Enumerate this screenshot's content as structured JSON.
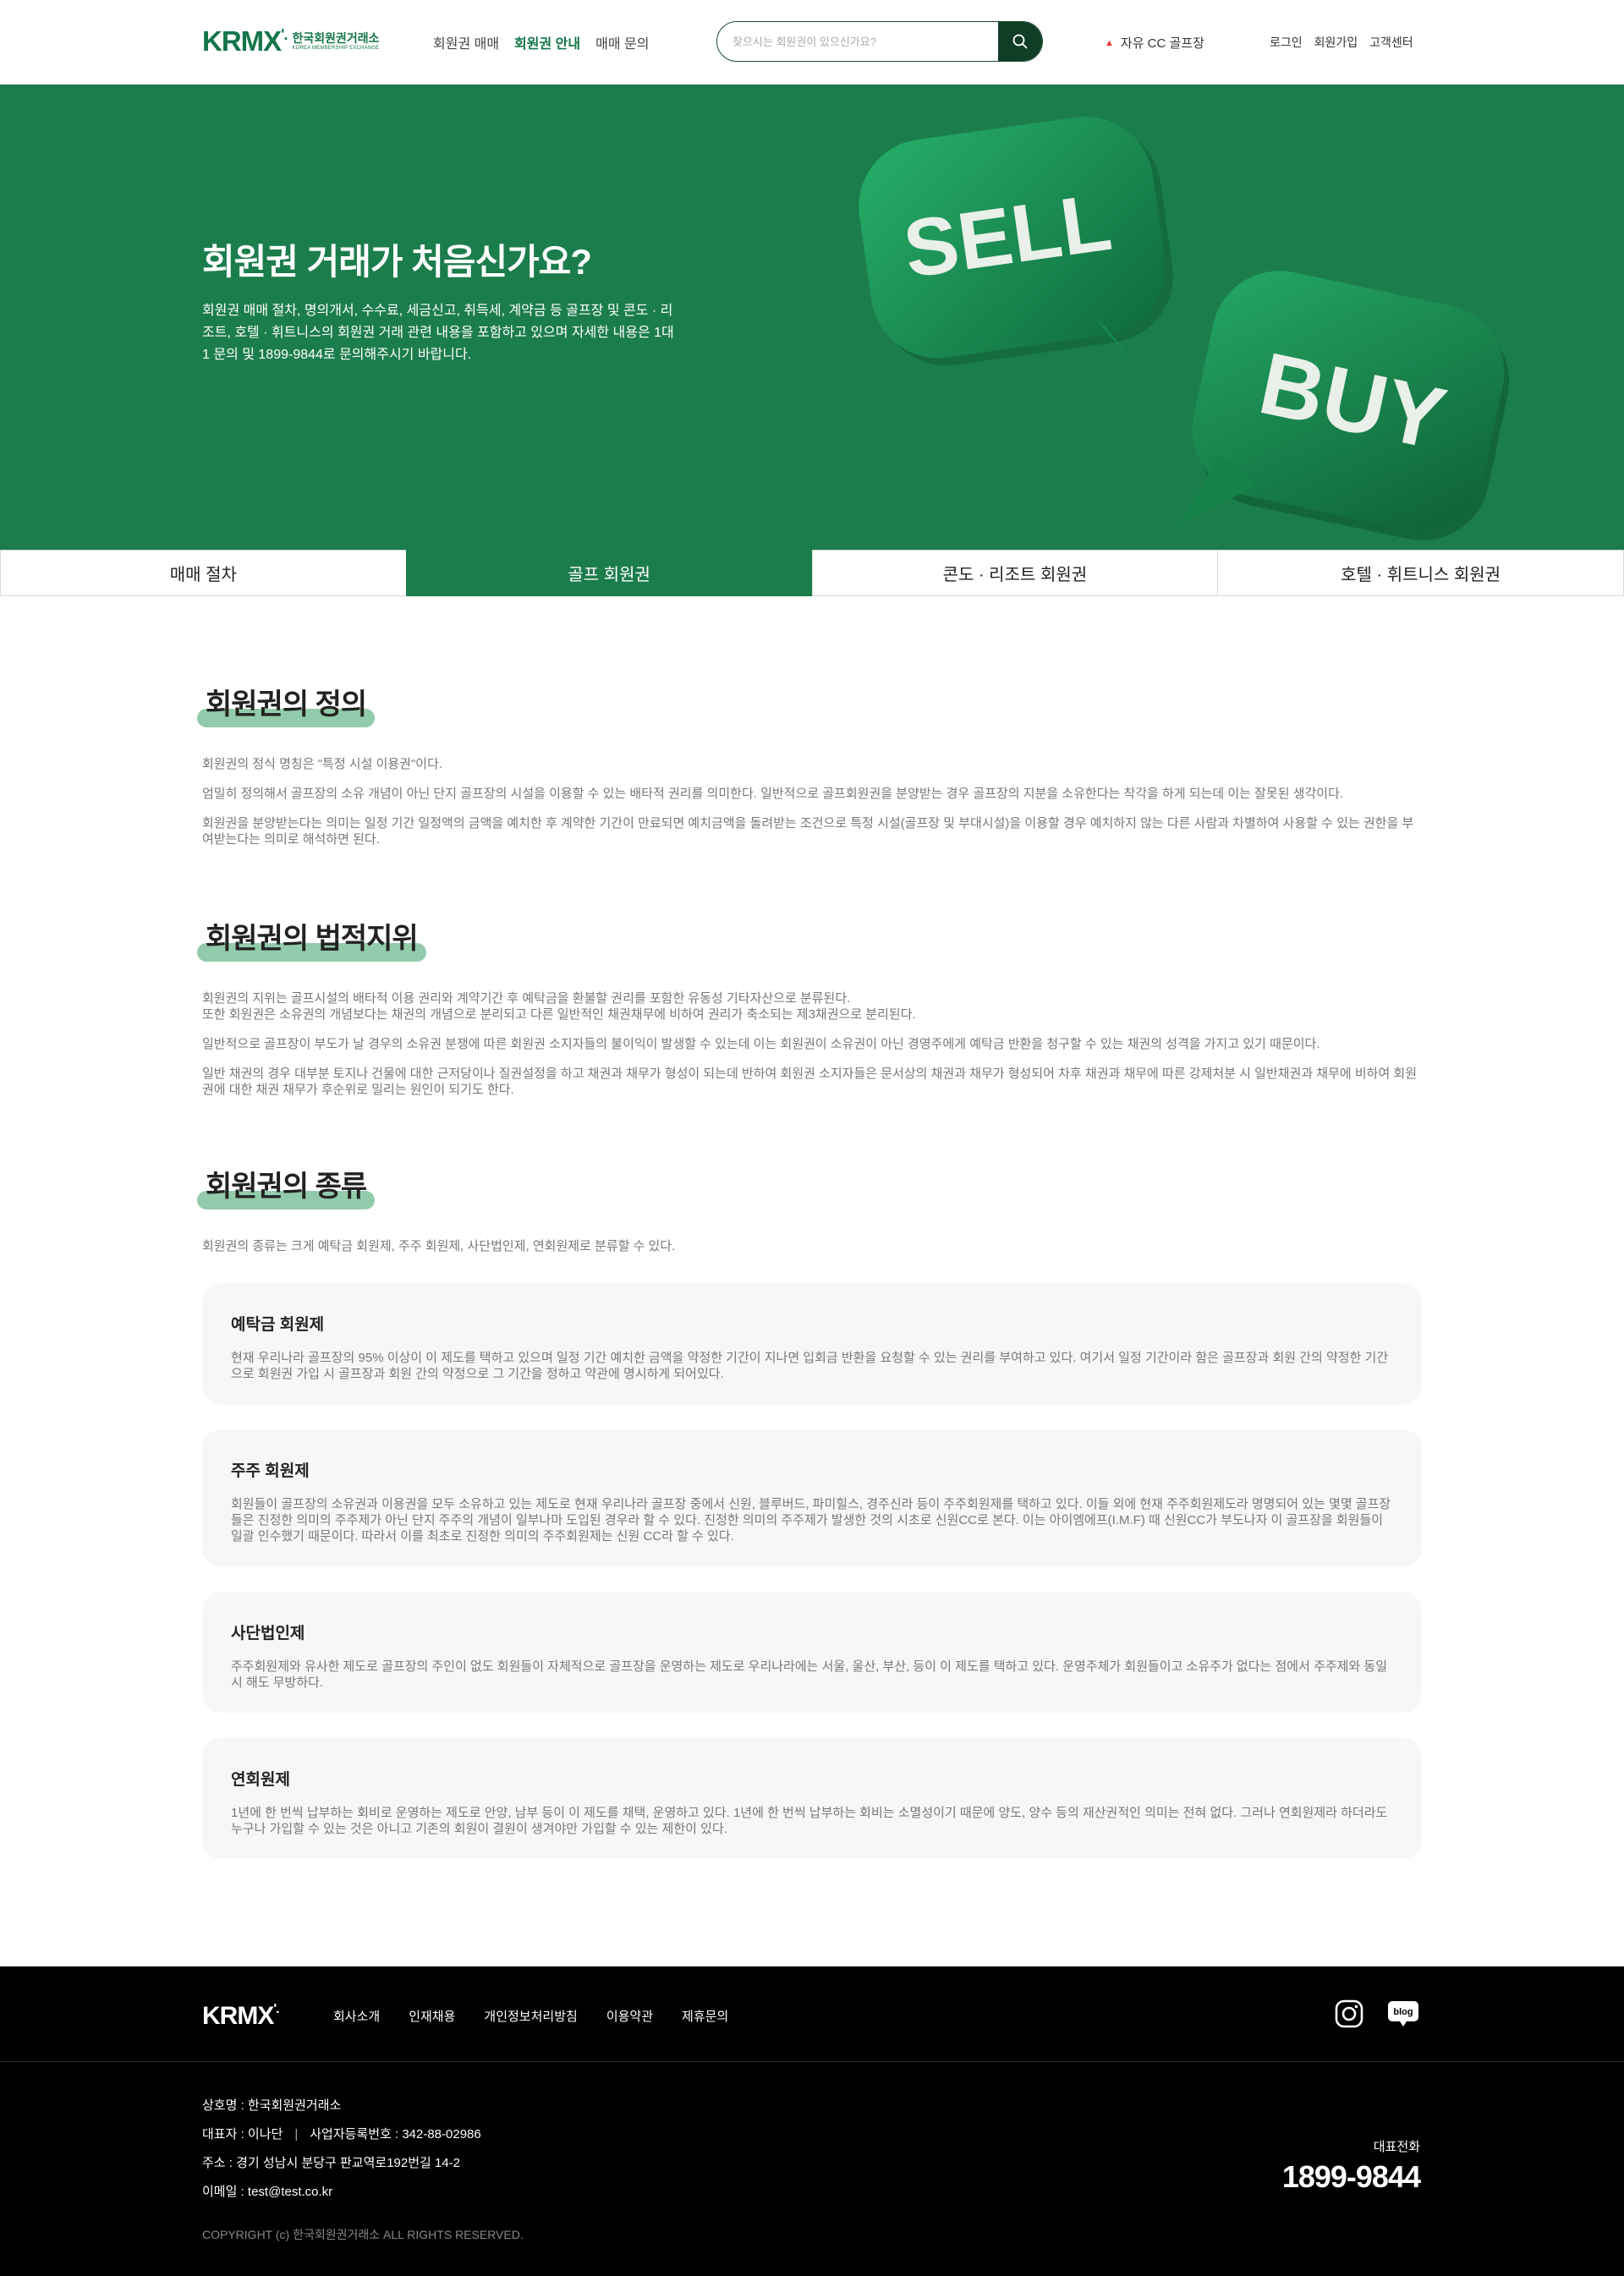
{
  "header": {
    "logo": {
      "mark": "KRMX",
      "mark_tick": "'.",
      "korean": "한국회원권거래소",
      "english": "KOREA MEMBERSHIP EXCHANGE"
    },
    "nav": [
      {
        "label": "회원권 매매"
      },
      {
        "label": "회원권 안내",
        "active": true
      },
      {
        "label": "매매 문의"
      }
    ],
    "search": {
      "placeholder": "찾으시는 회원권이 있으신가요?",
      "value": "",
      "icon": "search-icon"
    },
    "hot_item": {
      "icon": "up-arrow-icon",
      "label": "자유 CC 골프장"
    },
    "util": [
      {
        "label": "로그인"
      },
      {
        "label": "회원가입"
      },
      {
        "label": "고객센터"
      }
    ]
  },
  "hero": {
    "title": "회원권 거래가 처음신가요?",
    "description": "회원권 매매 절차, 명의개서, 수수료, 세금신고, 취득세, 계약금 등 골프장 및 콘도 · 리조트, 호텔 · 휘트니스의 회원권 거래 관련 내용을 포함하고 있으며 자세한 내용은 1대1 문의 및 1899-9844로 문의해주시기 바랍니다.",
    "bubble_sell": "SELL",
    "bubble_buy": "BUY",
    "colors": {
      "background": "#1c7d4c",
      "bubble": "#1e9a5c"
    }
  },
  "tabs": [
    {
      "label": "매매 절차",
      "active": false
    },
    {
      "label": "골프 회원권",
      "active": true
    },
    {
      "label": "콘도 · 리조트 회원권",
      "active": false
    },
    {
      "label": "호텔 · 휘트니스 회원권",
      "active": false
    }
  ],
  "sections": {
    "definition": {
      "title": "회원권의 정의",
      "paragraphs": [
        "회원권의 정식 명칭은 \"특정 시설 이용권\"이다.",
        "엄밀히 정의해서 골프장의 소유 개념이 아닌 단지 골프장의 시설을 이용할 수 있는 배타적 권리를 의미한다. 일반적으로 골프회원권을 분양받는 경우 골프장의 지분을 소유한다는 착각을 하게 되는데 이는 잘못된 생각이다.",
        "회원권을 분양받는다는 의미는 일정 기간 일정액의 금액을 예치한 후 계약한 기간이 만료되면 예치금액을 돌려받는 조건으로 특정 시설(골프장 및 부대시설)을 이용할 경우 예치하지 않는 다른 사람과 차별하여 사용할 수 있는 권한을 부여받는다는 의미로 해석하면 된다."
      ]
    },
    "legal": {
      "title": "회원권의 법적지위",
      "paragraphs": [
        "회원권의 지위는 골프시설의 배타적 이용 권리와 계약기간 후 예탁금을 환불할 권리를 포함한 유동성 기타자산으로 분류된다.",
        "또한 회원권은 소유권의 개념보다는 채권의 개념으로 분리되고 다른 일반적인 채권채무에 비하여 권리가 축소되는 제3채권으로 분리된다.",
        "일반적으로 골프장이 부도가 날 경우의 소유권 분쟁에 따른 회원권 소지자들의 불이익이 발생할 수 있는데 이는 회원권이 소유권이 아닌 경영주에게 예탁금 반환을 청구할 수 있는 채권의 성격을 가지고 있기 때문이다.",
        "일반 채권의 경우 대부분 토지나 건물에 대한 근저당이나 질권설정을 하고 채권과 채무가 형성이 되는데 반하여 회원권 소지자들은 문서상의 채권과 채무가 형성되어 차후 채권과 채무에 따른 강제처분 시 일반채권과 채무에 비하여 회원권에 대한 채권 채무가 후순위로 밀리는 원인이 되기도 한다."
      ]
    },
    "types": {
      "title": "회원권의 종류",
      "intro": "회원권의 종류는 크게 예탁금 회원제, 주주 회원제, 사단법인제, 연회원제로 분류할 수 있다.",
      "cards": [
        {
          "title": "예탁금 회원제",
          "text": "현재 우리나라 골프장의 95% 이상이 이 제도를 택하고 있으며 일정 기간 예치한 금액을 약정한 기간이 지나면 입회금 반환을 요청할 수 있는 권리를 부여하고 있다. 여기서 일정 기간이라 함은 골프장과 회원 간의 약정한 기간으로 회원권 가입 시 골프장과 회원 간의 약정으로 그 기간을 정하고 약관에 명시하게 되어있다."
        },
        {
          "title": "주주 회원제",
          "text": "회원들이 골프장의 소유권과 이용권을 모두 소유하고 있는 제도로 현재 우리나라 골프장 중에서 신원, 블루버드, 파미힐스, 경주신라 등이 주주회원제를 택하고 있다. 이들 외에 현재 주주회원제도라 명명되어 있는 몇몇 골프장들은 진정한 의미의 주주제가 아닌 단지 주주의 개념이 일부나마 도입된 경우라 할 수 있다. 진정한 의미의 주주제가 발생한 것의 시초로 신원CC로 본다. 이는 아이엠에프(I.M.F) 때 신원CC가 부도나자 이 골프장을 회원들이 일괄 인수했기 때문이다. 따라서 이를 최초로 진정한 의미의 주주회원제는 신원 CC라 할 수 있다."
        },
        {
          "title": "사단법인제",
          "text": "주주회원제와 유사한 제도로 골프장의 주인이 없도 회원들이 자체적으로 골프장을 운영하는 제도로 우리나라에는 서울, 울산, 부산, 등이 이 제도를 택하고 있다. 운영주체가 회원들이고 소유주가 없다는 점에서 주주제와 동일시 해도 무방하다."
        },
        {
          "title": "연회원제",
          "text": "1년에 한 번씩 납부하는 회비로 운영하는 제도로 안양, 남부 등이 이 제도를 채택, 운영하고 있다. 1년에 한 번씩 납부하는 회비는 소멸성이기 때문에 양도, 양수 등의 재산권적인 의미는 전혀 없다. 그러나 연회원제라 하더라도 누구나 가입할 수 있는 것은 아니고 기존의 회원이 결원이 생겨야만 가입할 수 있는 제한이 있다."
        }
      ]
    }
  },
  "footer": {
    "logo": "KRMX",
    "logo_tick": "'.",
    "links": [
      {
        "label": "회사소개"
      },
      {
        "label": "인재채용"
      },
      {
        "label": "개인정보처리방침"
      },
      {
        "label": "이용약관"
      },
      {
        "label": "제휴문의"
      }
    ],
    "sns": [
      {
        "icon": "instagram-icon"
      },
      {
        "icon": "blog-icon",
        "label": "blog"
      }
    ],
    "company": "상호명 : 한국회원권거래소",
    "ceo": "대표자 : 이나단",
    "biz_no": "사업자등록번호 : 342-88-02986",
    "address": "주소 : 경기 성남시 분당구 판교역로192번길 14-2",
    "email": "이메일 : test@test.co.kr",
    "copyright": "COPYRIGHT (c) 한국회원권거래소 ALL RIGHTS RESERVED.",
    "tel_label": "대표전화",
    "tel": "1899-9844"
  },
  "colors": {
    "brand": "#1c7d4c",
    "brand_dark": "#0f3d26",
    "highlight": "#7fc29c",
    "card_bg": "#f7f7f7"
  }
}
